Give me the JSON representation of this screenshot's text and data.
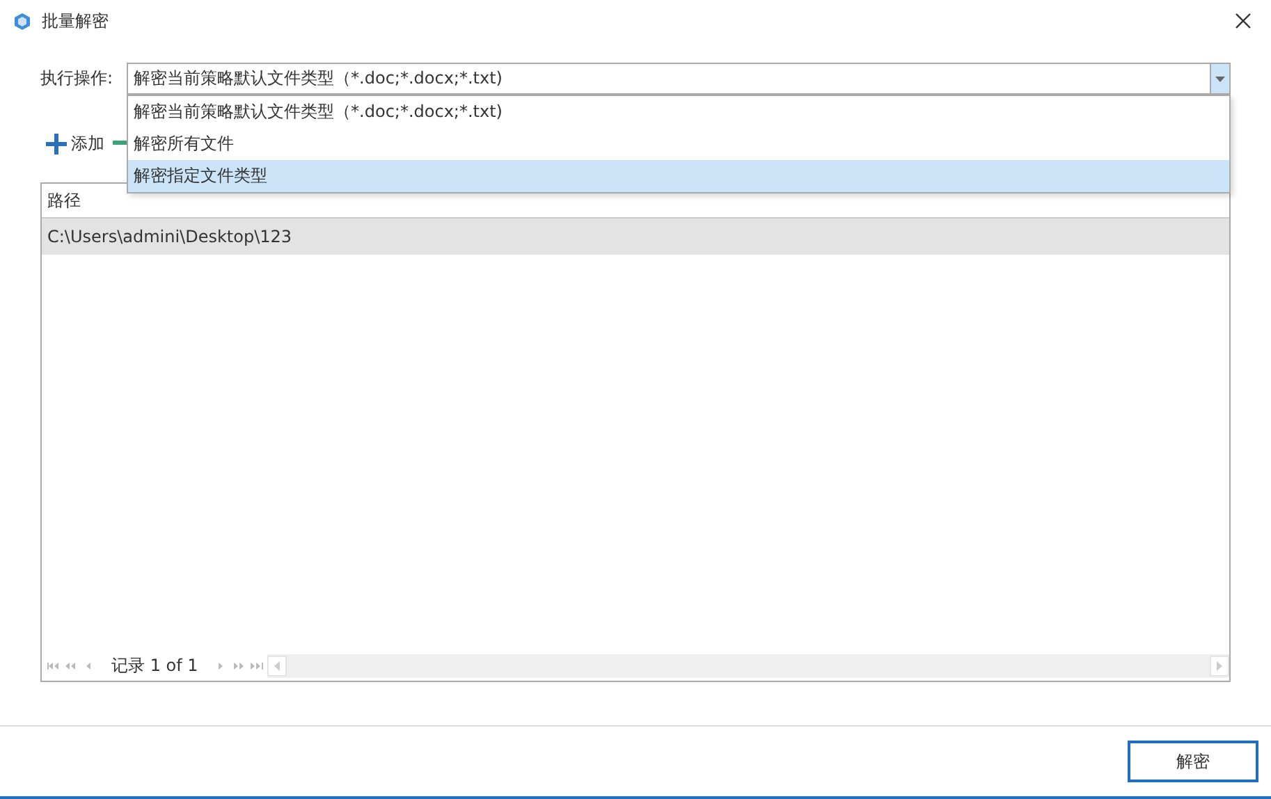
{
  "window": {
    "title": "批量解密"
  },
  "operation": {
    "label": "执行操作:",
    "value": "解密当前策略默认文件类型（*.doc;*.docx;*.txt)",
    "expanded": true,
    "options": [
      {
        "label": "解密当前策略默认文件类型（*.doc;*.docx;*.txt)",
        "highlighted": false
      },
      {
        "label": "解密所有文件",
        "highlighted": false
      },
      {
        "label": "解密指定文件类型",
        "highlighted": true
      }
    ]
  },
  "toolbar": {
    "add": "添加"
  },
  "table": {
    "columns": [
      "路径"
    ],
    "rows": [
      {
        "path": "C:\\Users\\admini\\Desktop\\123",
        "selected": true
      }
    ]
  },
  "pager": {
    "text": "记录 1 of 1"
  },
  "buttons": {
    "decrypt": "解密"
  }
}
